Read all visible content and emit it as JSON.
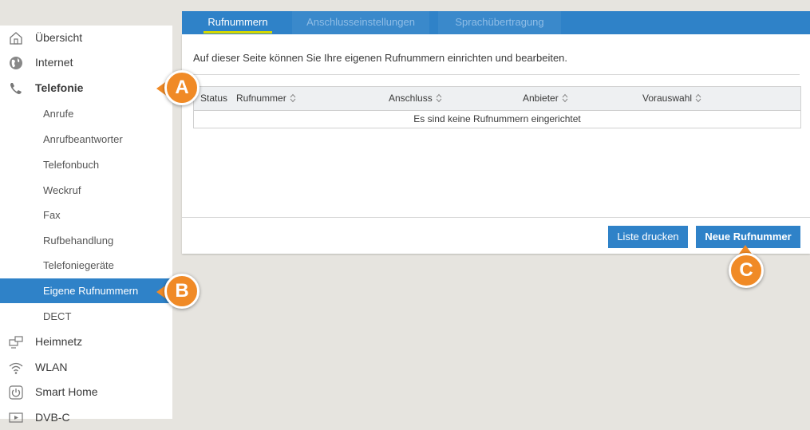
{
  "tabs": [
    {
      "label": "Rufnummern",
      "active": true
    },
    {
      "label": "Anschlusseinstellungen",
      "active": false
    },
    {
      "label": "Sprachübertragung",
      "active": false
    }
  ],
  "sidebar": {
    "items": [
      {
        "label": "Übersicht",
        "icon": "home-icon",
        "level": "top"
      },
      {
        "label": "Internet",
        "icon": "globe-icon",
        "level": "top"
      },
      {
        "label": "Telefonie",
        "icon": "phone-icon",
        "level": "top",
        "bold": true
      },
      {
        "label": "Anrufe",
        "level": "sub"
      },
      {
        "label": "Anrufbeantworter",
        "level": "sub"
      },
      {
        "label": "Telefonbuch",
        "level": "sub"
      },
      {
        "label": "Weckruf",
        "level": "sub"
      },
      {
        "label": "Fax",
        "level": "sub"
      },
      {
        "label": "Rufbehandlung",
        "level": "sub"
      },
      {
        "label": "Telefoniegeräte",
        "level": "sub"
      },
      {
        "label": "Eigene Rufnummern",
        "level": "sub",
        "active": true
      },
      {
        "label": "DECT",
        "level": "sub"
      },
      {
        "label": "Heimnetz",
        "icon": "network-icon",
        "level": "top"
      },
      {
        "label": "WLAN",
        "icon": "wifi-icon",
        "level": "top"
      },
      {
        "label": "Smart Home",
        "icon": "power-icon",
        "level": "top"
      },
      {
        "label": "DVB-C",
        "icon": "tv-icon",
        "level": "top"
      }
    ]
  },
  "main": {
    "intro": "Auf dieser Seite können Sie Ihre eigenen Rufnummern einrichten und bearbeiten.",
    "table": {
      "columns": [
        "Status",
        "Rufnummer",
        "Anschluss",
        "Anbieter",
        "Vorauswahl"
      ],
      "empty_message": "Es sind keine Rufnummern eingerichtet"
    },
    "buttons": {
      "print": "Liste drucken",
      "new": "Neue Rufnummer"
    }
  },
  "callouts": [
    "A",
    "B",
    "C"
  ],
  "colors": {
    "accent": "#2f82c8",
    "tab_underline": "#d7d900",
    "callout": "#f08a26",
    "background": "#e6e4df"
  }
}
